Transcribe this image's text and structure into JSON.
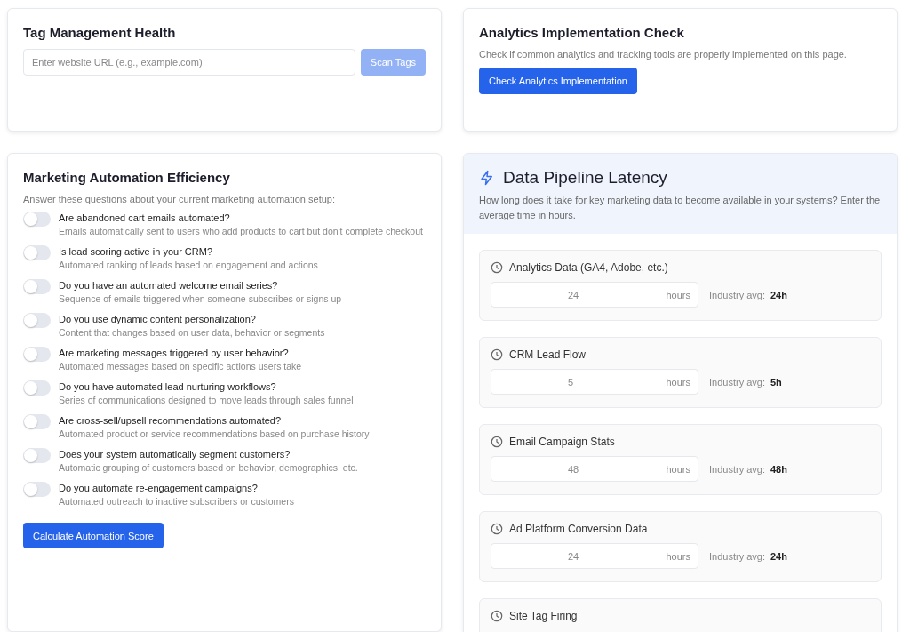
{
  "tag_management": {
    "title": "Tag Management Health",
    "url_field": {
      "placeholder": "Enter website URL (e.g., example.com)"
    },
    "scan_button": {
      "label": "Scan Tags",
      "disabled": true
    }
  },
  "analytics_check": {
    "title": "Analytics Implementation Check",
    "description": "Check if common analytics and tracking tools are properly implemented on this page.",
    "button": "Check Analytics Implementation"
  },
  "marketing_automation": {
    "title": "Marketing Automation Efficiency",
    "intro": "Answer these questions about your current marketing automation setup:",
    "questions": [
      {
        "question": "Are abandoned cart emails automated?",
        "description": "Emails automatically sent to users who add products to cart but don't complete checkout",
        "on": false
      },
      {
        "question": "Is lead scoring active in your CRM?",
        "description": "Automated ranking of leads based on engagement and actions",
        "on": false
      },
      {
        "question": "Do you have an automated welcome email series?",
        "description": "Sequence of emails triggered when someone subscribes or signs up",
        "on": false
      },
      {
        "question": "Do you use dynamic content personalization?",
        "description": "Content that changes based on user data, behavior or segments",
        "on": false
      },
      {
        "question": "Are marketing messages triggered by user behavior?",
        "description": "Automated messages based on specific actions users take",
        "on": false
      },
      {
        "question": "Do you have automated lead nurturing workflows?",
        "description": "Series of communications designed to move leads through sales funnel",
        "on": false
      },
      {
        "question": "Are cross-sell/upsell recommendations automated?",
        "description": "Automated product or service recommendations based on purchase history",
        "on": false
      },
      {
        "question": "Does your system automatically segment customers?",
        "description": "Automatic grouping of customers based on behavior, demographics, etc.",
        "on": false
      },
      {
        "question": "Do you automate re-engagement campaigns?",
        "description": "Automated outreach to inactive subscribers or customers",
        "on": false
      }
    ],
    "button": "Calculate Automation Score"
  },
  "data_pipeline": {
    "title": "Data Pipeline Latency",
    "description": "How long does it take for key marketing data to become available in your systems? Enter the average time in hours.",
    "sources": [
      {
        "name": "Analytics Data (GA4, Adobe, etc.)",
        "value": "24",
        "unit": "hours",
        "avg_label": "Industry avg:",
        "avg": "24h"
      },
      {
        "name": "CRM Lead Flow",
        "value": "5",
        "unit": "hours",
        "avg_label": "Industry avg:",
        "avg": "5h"
      },
      {
        "name": "Email Campaign Stats",
        "value": "48",
        "unit": "hours",
        "avg_label": "Industry avg:",
        "avg": "48h"
      },
      {
        "name": "Ad Platform Conversion Data",
        "value": "24",
        "unit": "hours",
        "avg_label": "Industry avg:",
        "avg": "24h"
      },
      {
        "name": "Site Tag Firing"
      }
    ]
  }
}
